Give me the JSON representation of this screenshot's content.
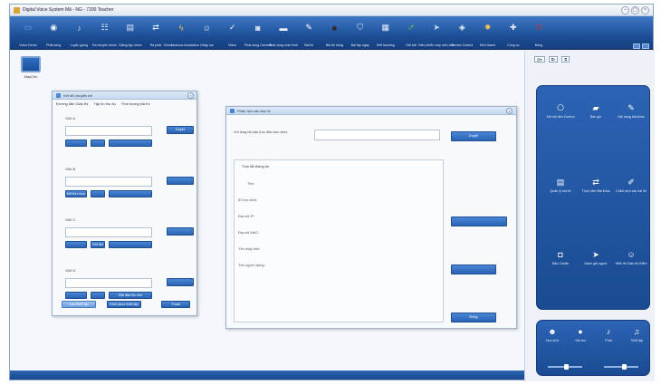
{
  "window": {
    "title": "Digital Voice System Mã - NG - 7200 Teacher",
    "controls": [
      "–",
      "▢",
      "×"
    ]
  },
  "toolbar": {
    "items": [
      {
        "label": "Voice Demo",
        "icon": "monitor-icon",
        "color": "#6fa6e6"
      },
      {
        "label": "Phát sóng",
        "icon": "broadcast-icon",
        "color": "#f0f4fa"
      },
      {
        "label": "Luyện giọng",
        "icon": "speaker-icon",
        "color": "#cfe0f7"
      },
      {
        "label": "Ra chuyên nhóm",
        "icon": "group-icon",
        "color": "#e8eef7"
      },
      {
        "label": "Giảng tập nhóm",
        "icon": "book-icon",
        "color": "#dce8f6"
      },
      {
        "label": "Ra phát",
        "icon": "exchange-icon",
        "color": "#e6eef8"
      },
      {
        "label": "Simultaneous translation",
        "icon": "flash-icon",
        "color": "#f5c542"
      },
      {
        "label": "Nhập vai",
        "icon": "people-icon",
        "color": "#dfe9f6"
      },
      {
        "label": "Video",
        "icon": "check-icon",
        "color": "#f1f5fb"
      },
      {
        "label": "Phát sóng Camera",
        "icon": "camera-icon",
        "color": "#e1eaf6"
      },
      {
        "label": "Phát sóng màn hình",
        "icon": "screen-icon",
        "color": "#eaf0f8"
      },
      {
        "label": "Bài thi",
        "icon": "pen-icon",
        "color": "#ffffff"
      },
      {
        "label": "Bài thi nóng",
        "icon": "board-icon",
        "color": "#2b2b2b"
      },
      {
        "label": "Bài tập ngày",
        "icon": "shield-icon",
        "color": "#d9e5f5"
      },
      {
        "label": "Self learning",
        "icon": "grid-icon",
        "color": "#e7eef8"
      },
      {
        "label": "Gửi bài",
        "icon": "user-send-icon",
        "color": "#6fb24e"
      },
      {
        "label": "Điều khiển máy sinh viên",
        "icon": "arrow-icon",
        "color": "#c9d9ee"
      },
      {
        "label": "Device Control",
        "icon": "lock-icon",
        "color": "#e9f0f9"
      },
      {
        "label": "Mini Game",
        "icon": "gear-icon",
        "color": "#f2c14e"
      },
      {
        "label": "Công cụ",
        "icon": "tools-icon",
        "color": "#e4ecf7"
      },
      {
        "label": "Đóng",
        "icon": "power-icon",
        "color": "#d9342b"
      }
    ]
  },
  "desktop": {
    "icon_label": "MayChu"
  },
  "dialog_files": {
    "title": "Kết dữ chuyển tới",
    "tabs": [
      "Đường dẫn Giấu thị",
      "Tập tin thu âu",
      "Thời lượng bài thi"
    ],
    "groups": [
      {
        "label": "Giữi A",
        "browse": "Duyệt",
        "buttons": [
          "",
          "",
          ""
        ]
      },
      {
        "label": "Giữi B",
        "browse": "",
        "buttons": [
          "Mở thư mục",
          "",
          ""
        ]
      },
      {
        "label": "Giữi C",
        "browse": "",
        "buttons": [
          "",
          "Ghi âm",
          ""
        ]
      },
      {
        "label": "Giữi D",
        "browse": "",
        "buttons": [
          "",
          "",
          "Bắt đầu thu âm"
        ]
      }
    ],
    "footer_buttons": [
      "Lưu thiết lập",
      "Khôi phục thiết lập",
      "Thoát"
    ]
  },
  "dialog_analysis": {
    "title": "Phân tích cấu trúc tệ",
    "prompt_label": "Vui lòng tải cấu trúc đầu học sinh:",
    "input_value": "",
    "browse_button": "Duyệt",
    "summary_title": "Tóm tắt thông tin",
    "fields": [
      "Tên:",
      "ID học sinh:",
      "Địa chỉ IP:",
      "Địa chỉ MAC:",
      "Tên máy tính:",
      "Tên người dùng:"
    ],
    "side_buttons": [
      "",
      "",
      "Đóng"
    ]
  },
  "panel": {
    "top_buttons": [
      "▥▾",
      "⧉▾",
      "⧉"
    ],
    "items": [
      {
        "label": "Kết nối đến Control",
        "icon": "network-icon"
      },
      {
        "label": "Bàn ghi",
        "icon": "folder-icon"
      },
      {
        "label": "Nội dung bài khóa",
        "icon": "pen-icon"
      },
      {
        "label": "Quản lý bài thi",
        "icon": "book-icon"
      },
      {
        "label": "Thực hiện Bài khóa",
        "icon": "exchange-icon"
      },
      {
        "label": "Chỉnh sửa các bài thi",
        "icon": "edit-icon"
      },
      {
        "label": "Bảo Chuẩn",
        "icon": "bag-icon"
      },
      {
        "label": "Đánh giá người",
        "icon": "arrow-icon"
      },
      {
        "label": "Hiển thị Giấu thị Kiểm",
        "icon": "people-icon"
      }
    ],
    "audio": [
      {
        "label": "Học sinh",
        "icon": "students-icon"
      },
      {
        "label": "Ghi âm",
        "icon": "mic-icon"
      },
      {
        "label": "Phát",
        "icon": "speaker-icon"
      },
      {
        "label": "Thiết lập",
        "icon": "headset-icon"
      }
    ],
    "volume_levels": [
      0.55,
      0.6
    ]
  }
}
